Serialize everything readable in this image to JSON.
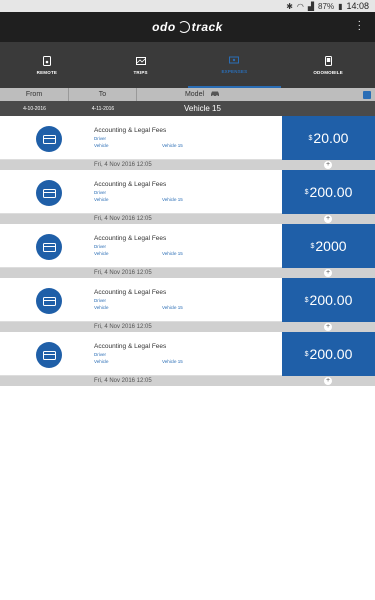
{
  "status": {
    "time": "14:08",
    "battery": "87%"
  },
  "app": {
    "logo_left": "odo",
    "logo_right": "track"
  },
  "tabs": [
    {
      "label": "REMOTE",
      "icon": "remote-icon",
      "active": false
    },
    {
      "label": "TRIPS",
      "icon": "map-icon",
      "active": false
    },
    {
      "label": "EXPENSES",
      "icon": "cash-icon",
      "active": true
    },
    {
      "label": "ODOMOBILE",
      "icon": "phone-icon",
      "active": false
    }
  ],
  "filters": {
    "from_label": "From",
    "from_value": "4-10-2016",
    "to_label": "To",
    "to_value": "4-11-2016",
    "model_label": "Model",
    "vehicle": "Vehicle 15"
  },
  "expenses": [
    {
      "category": "Accounting & Legal Fees",
      "driver": "Driver",
      "vehicle_label": "Vehicle",
      "vehicle": "Vehicle 15",
      "currency": "$",
      "amount": "20.00",
      "date": "Fri, 4 Nov 2016 12:05"
    },
    {
      "category": "Accounting & Legal Fees",
      "driver": "Driver",
      "vehicle_label": "Vehicle",
      "vehicle": "Vehicle 15",
      "currency": "$",
      "amount": "200.00",
      "date": "Fri, 4 Nov 2016 12:05"
    },
    {
      "category": "Accounting & Legal Fees",
      "driver": "Driver",
      "vehicle_label": "Vehicle",
      "vehicle": "Vehicle 15",
      "currency": "$",
      "amount": "2000",
      "date": "Fri, 4 Nov 2016 12:05"
    },
    {
      "category": "Accounting & Legal Fees",
      "driver": "Driver",
      "vehicle_label": "Vehicle",
      "vehicle": "Vehicle 15",
      "currency": "$",
      "amount": "200.00",
      "date": "Fri, 4 Nov 2016 12:05"
    },
    {
      "category": "Accounting & Legal Fees",
      "driver": "Driver",
      "vehicle_label": "Vehicle",
      "vehicle": "Vehicle 15",
      "currency": "$",
      "amount": "200.00",
      "date": "Fri, 4 Nov 2016 12:05"
    }
  ],
  "colors": {
    "accent": "#1f5fa8",
    "tabbar": "#3a3a3a",
    "appbar": "#1f1f1f"
  }
}
